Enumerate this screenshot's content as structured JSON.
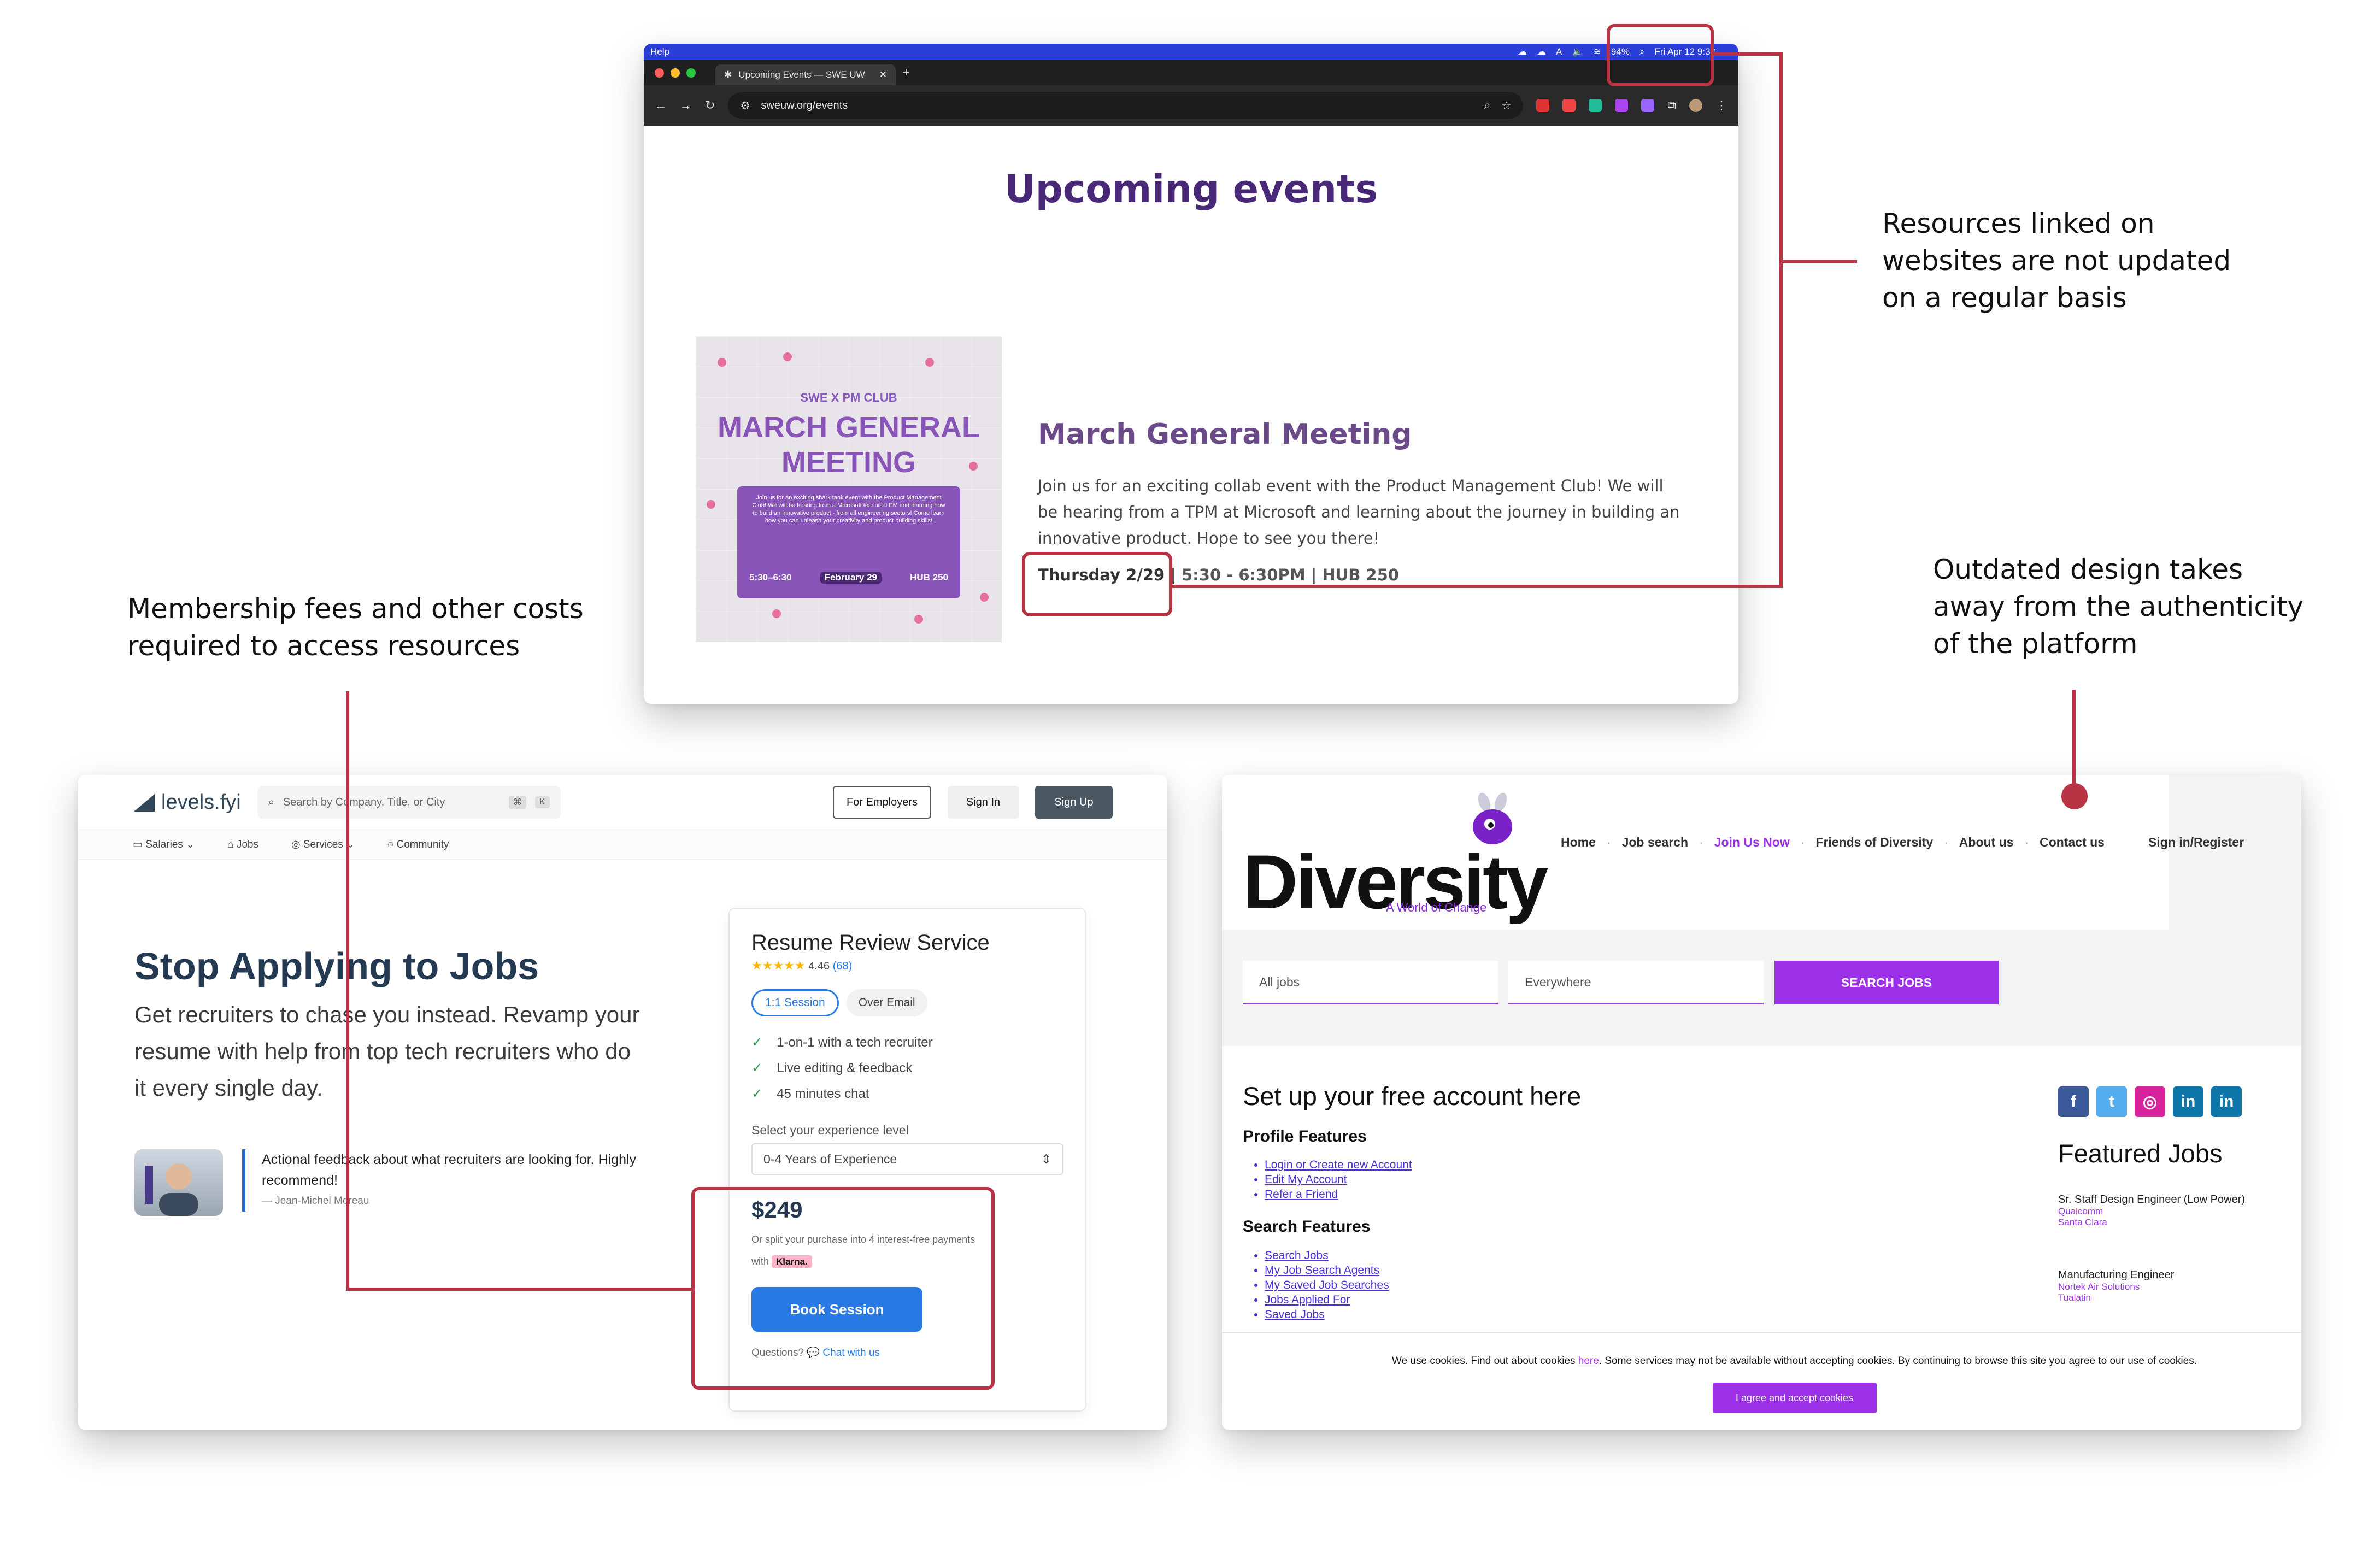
{
  "annotations": {
    "right_top": [
      "Resources linked on",
      "websites are not updated",
      "on a regular basis"
    ],
    "left_mid": [
      "Membership fees and other costs",
      "required to access resources"
    ],
    "right_mid": [
      "Outdated design takes",
      "away from the authenticity",
      "of the platform"
    ]
  },
  "swe": {
    "menubar_app": "Help",
    "battery": "94%",
    "clock": "Fri Apr 12  9:33",
    "tab_title": "Upcoming Events — SWE UW",
    "url": "sweuw.org/events",
    "page_title": "Upcoming events",
    "poster": {
      "club": "SWE X PM CLUB",
      "title_line1": "MARCH GENERAL",
      "title_line2": "MEETING",
      "blurb": "Join us for an exciting shark tank event with the Product Management Club! We will be hearing from a Microsoft technical PM and learning how to build an innovative product - from all engineering sectors! Come learn how you can unleash your creativity and product building skills!",
      "time": "5:30–6:30",
      "date": "February 29",
      "room": "HUB 250"
    },
    "event_title": "March General Meeting",
    "event_desc": "Join us for an exciting collab event with the Product Management Club! We will be hearing from a TPM at Microsoft and learning about the journey in building an innovative product. Hope to see you there!",
    "event_date": "Thursday 2/29",
    "event_rest": " | 5:30 - 6:30PM | HUB 250"
  },
  "levels": {
    "logo": "levels.fyi",
    "search_placeholder": "Search by Company, Title, or City",
    "kbd1": "⌘",
    "kbd2": "K",
    "btn_employers": "For Employers",
    "btn_signin": "Sign In",
    "btn_signup": "Sign Up",
    "subnav": [
      "Salaries ⌄",
      "Jobs",
      "Services ⌄",
      "Community"
    ],
    "headline": "Stop Applying to Jobs",
    "subhead": "Get recruiters to chase you instead. Revamp your resume with help from top tech recruiters who do it every single day.",
    "quote": "Actional feedback about what recruiters are looking for. Highly recommend!",
    "quote_author": "— Jean-Michel Moreau",
    "card": {
      "title": "Resume Review Service",
      "rating": "4.46",
      "reviews": "(68)",
      "toggle_active": "1:1 Session",
      "toggle_other": "Over Email",
      "features": [
        "1-on-1 with a tech recruiter",
        "Live editing & feedback",
        "45 minutes chat"
      ],
      "select_label": "Select your experience level",
      "select_value": "0-4 Years of Experience",
      "price": "$249",
      "split": "Or split your purchase into 4 interest-free payments with",
      "klarna": "Klarna.",
      "book": "Book Session",
      "questions": "Questions?",
      "chat": "Chat with us"
    }
  },
  "diversity": {
    "logo": "Diversity",
    "tagline": "A World of Change",
    "nav": [
      "Home",
      "Job search",
      "Join Us Now",
      "Friends of Diversity",
      "About us",
      "Contact us"
    ],
    "signin": "Sign in/Register",
    "jobs_placeholder": "All jobs",
    "where_placeholder": "Everywhere",
    "search_btn": "SEARCH JOBS",
    "setup": "Set up your free account here",
    "profile_h": "Profile Features",
    "profile_links": [
      "Login or Create new Account",
      "Edit My Account",
      "Refer a Friend"
    ],
    "search_h": "Search Features",
    "search_links": [
      "Search Jobs",
      "My Job Search Agents",
      "My Saved Job Searches",
      "Jobs Applied For",
      "Saved Jobs"
    ],
    "featured": "Featured Jobs",
    "jobs": [
      {
        "title": "Sr. Staff Design Engineer (Low Power)",
        "company": "Qualcomm",
        "city": "Santa Clara"
      },
      {
        "title": "Manufacturing Engineer",
        "company": "Nortek Air Solutions",
        "city": "Tualatin"
      }
    ],
    "cookie_pre": "We use cookies. Find out about cookies ",
    "cookie_link": "here",
    "cookie_post": ". Some services may not be available without accepting cookies. By continuing to browse this site you agree to our use of cookies.",
    "cookie_btn": "I agree and accept cookies"
  },
  "colors": {
    "annotation_red": "#b83344",
    "swe_purple": "#4a2878",
    "levels_blue": "#2a7ae6",
    "diversity_purple": "#9b30e6"
  }
}
